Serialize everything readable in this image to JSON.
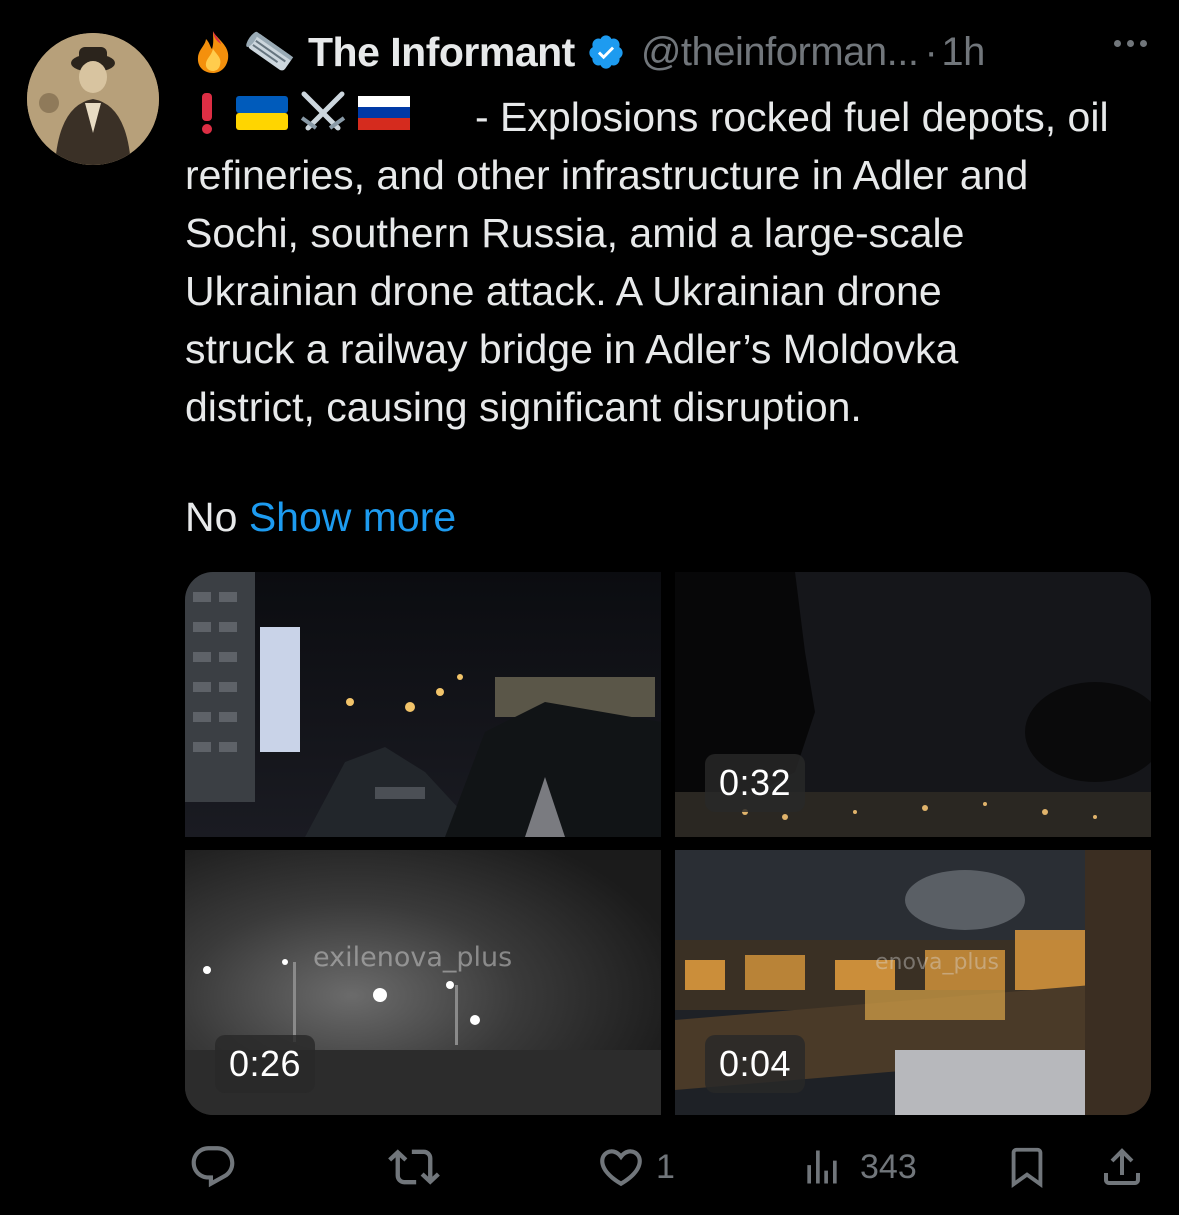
{
  "tweet": {
    "author_name": "The Informant",
    "handle": "@theinforman...",
    "separator": "·",
    "time": "1h",
    "prefix_emojis": [
      "fire-emoji",
      "newspaper-emoji"
    ],
    "line1_emojis": [
      "exclamation-emoji",
      "ukraine-flag-emoji",
      "crossed-swords-emoji",
      "russia-flag-emoji"
    ],
    "text_lines": [
      "- Explosions rocked fuel depots, oil",
      "refineries, and other infrastructure in Adler and",
      "Sochi, southern Russia, amid a large-scale",
      "Ukrainian drone attack. A Ukrainian drone",
      "struck a railway bridge in Adler’s Moldovka",
      "district, causing significant disruption."
    ],
    "truncated_word": "No",
    "show_more": "Show more"
  },
  "media": [
    {
      "kind": "video",
      "duration": ""
    },
    {
      "kind": "video",
      "duration": "0:32"
    },
    {
      "kind": "video",
      "duration": "0:26",
      "watermark": "exilenova_plus"
    },
    {
      "kind": "video",
      "duration": "0:04",
      "watermark": "enova_plus"
    }
  ],
  "actions": {
    "reply_count": "",
    "repost_count": "",
    "like_count": "1",
    "views_count": "343"
  },
  "colors": {
    "background": "#000000",
    "text": "#e7e9ea",
    "muted": "#71767b",
    "accent": "#1d9bf0"
  }
}
